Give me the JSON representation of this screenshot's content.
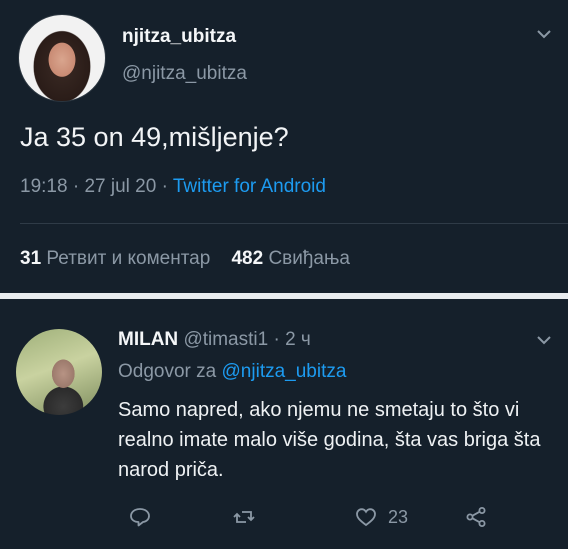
{
  "main_tweet": {
    "display_name": "njitza_ubitza",
    "handle": "@njitza_ubitza",
    "text": "Ja 35 on 49,mišljenje?",
    "time": "19:18",
    "separator": "·",
    "date": "27 jul 20",
    "source": "Twitter for Android",
    "retweets_count": "31",
    "retweets_label": "Ретвит и коментар",
    "likes_count": "482",
    "likes_label": "Свиђања"
  },
  "reply_tweet": {
    "display_name": "MILAN",
    "handle": "@timasti1",
    "separator": "·",
    "age": "2 ч",
    "replying_prefix": "Odgovor za",
    "replying_to": "@njitza_ubitza",
    "text": "Samo napred, ako njemu ne smetaju to što vi realno imate malo više godina, šta vas briga šta narod priča.",
    "like_count": "23"
  },
  "colors": {
    "background": "#15202b",
    "accent": "#1d9bf0",
    "secondary_text": "#8b98a5"
  },
  "icons": [
    "chevron-down-icon",
    "reply-icon",
    "retweet-icon",
    "like-icon",
    "share-icon"
  ]
}
